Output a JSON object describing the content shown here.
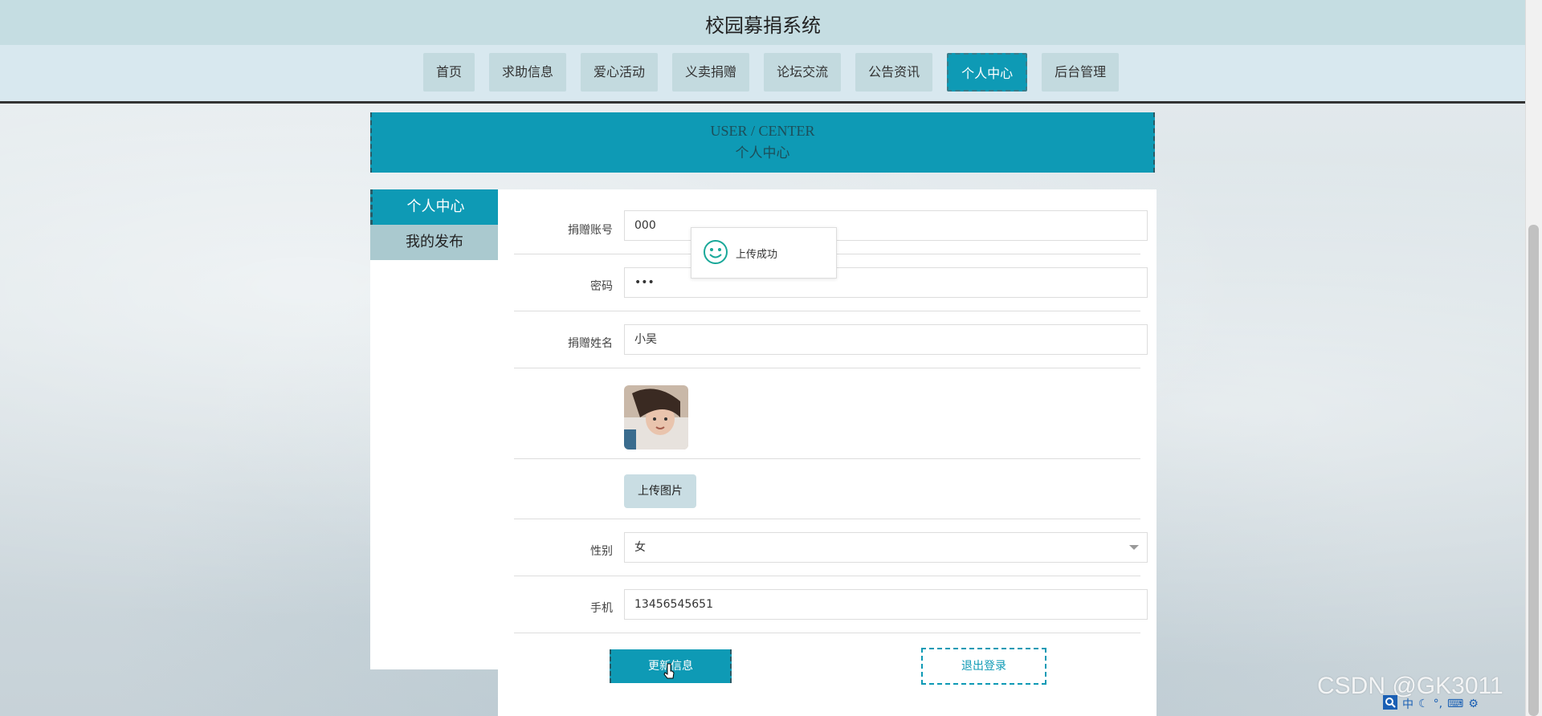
{
  "site": {
    "title": "校园募捐系统"
  },
  "nav": {
    "items": [
      {
        "label": "首页"
      },
      {
        "label": "求助信息"
      },
      {
        "label": "爱心活动"
      },
      {
        "label": "义卖捐赠"
      },
      {
        "label": "论坛交流"
      },
      {
        "label": "公告资讯"
      },
      {
        "label": "个人中心",
        "active": true
      },
      {
        "label": "后台管理"
      }
    ]
  },
  "banner": {
    "en": "USER / CENTER",
    "cn": "个人中心"
  },
  "sidebar": {
    "items": [
      {
        "label": "个人中心",
        "active": true
      },
      {
        "label": "我的发布"
      }
    ]
  },
  "form": {
    "account": {
      "label": "捐赠账号",
      "value": "000"
    },
    "password": {
      "label": "密码",
      "value": "•••"
    },
    "name": {
      "label": "捐赠姓名",
      "value": "小吴"
    },
    "avatar": {
      "alt": "avatar-photo"
    },
    "upload": {
      "label": "上传图片"
    },
    "gender": {
      "label": "性别",
      "value": "女"
    },
    "phone": {
      "label": "手机",
      "value": "13456545651"
    }
  },
  "buttons": {
    "update": "更新信息",
    "logout": "退出登录"
  },
  "toast": {
    "text": "上传成功"
  },
  "watermark": "CSDN @GK3011",
  "tray": {
    "ime": "中"
  },
  "colors": {
    "accent": "#0e9ab5",
    "nav_bg": "#c3dadf",
    "header_bg": "#c5dde2"
  }
}
